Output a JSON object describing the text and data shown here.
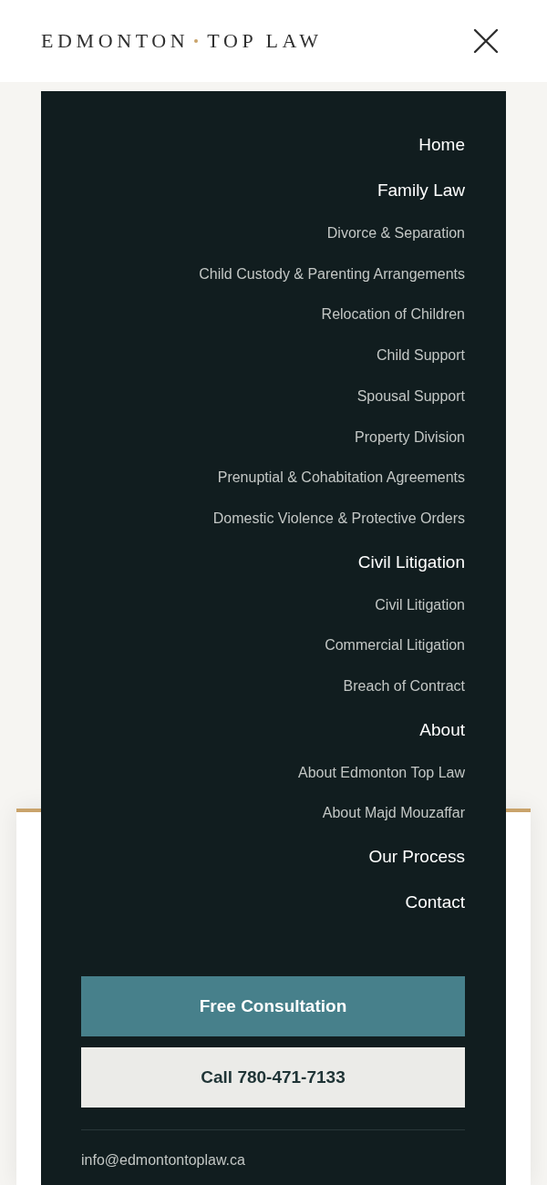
{
  "logo": {
    "words": [
      "EDMONTON",
      "TOP LAW"
    ]
  },
  "menu": {
    "items": [
      {
        "label": "Home"
      },
      {
        "label": "Family Law",
        "children": [
          {
            "label": "Divorce & Separation"
          },
          {
            "label": "Child Custody & Parenting Arrangements"
          },
          {
            "label": "Relocation of Children"
          },
          {
            "label": "Child Support"
          },
          {
            "label": "Spousal Support"
          },
          {
            "label": "Property Division"
          },
          {
            "label": "Prenuptial & Cohabitation Agreements"
          },
          {
            "label": "Domestic Violence & Protective Orders"
          }
        ]
      },
      {
        "label": "Civil Litigation",
        "children": [
          {
            "label": "Civil Litigation"
          },
          {
            "label": "Commercial Litigation"
          },
          {
            "label": "Breach of Contract"
          }
        ]
      },
      {
        "label": "About",
        "children": [
          {
            "label": "About Edmonton Top Law"
          },
          {
            "label": "About Majd Mouzaffar"
          }
        ]
      },
      {
        "label": "Our Process"
      },
      {
        "label": "Contact"
      }
    ]
  },
  "buttons": [
    {
      "label": "Free Consultation",
      "kind": "primary"
    },
    {
      "label": "Call 780-471-7133",
      "kind": "secondary"
    }
  ],
  "email": "info@edmontontoplaw.ca"
}
